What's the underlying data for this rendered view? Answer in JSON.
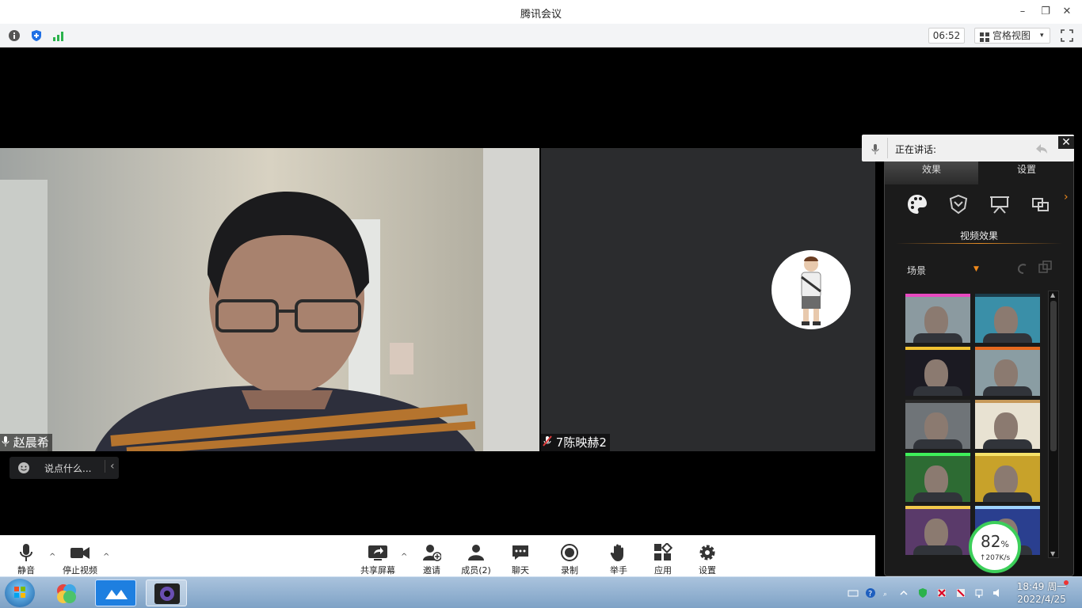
{
  "window": {
    "title": "腾讯会议",
    "minimize": "–",
    "restore": "❐",
    "close": "✕"
  },
  "toolbar": {
    "timer": "06:52",
    "view_mode": "宫格视图",
    "view_caret": "▾"
  },
  "participants": [
    {
      "name": "赵晨希",
      "muted": false
    },
    {
      "name": "7陈映赫2",
      "muted": true
    }
  ],
  "chat": {
    "placeholder": "说点什么...",
    "collapse": "‹"
  },
  "controls": {
    "mute": "静音",
    "stop_video": "停止视频",
    "share_screen": "共享屏幕",
    "invite": "邀请",
    "members": "成员(2)",
    "chat": "聊天",
    "record": "录制",
    "raise_hand": "举手",
    "apps": "应用",
    "settings": "设置",
    "caret": "^"
  },
  "effects_panel": {
    "speaking_label": "正在讲话:",
    "close": "✕",
    "tabs": [
      "效果",
      "设置"
    ],
    "section_title": "视频效果",
    "scene_label": "场景",
    "scene_caret": "▼",
    "more": "›",
    "thumbnails": [
      {
        "bg": "#8b9aa0",
        "accent": "#e84ac0"
      },
      {
        "bg": "#3a8fa8",
        "accent": "#1b3b4a"
      },
      {
        "bg": "#1b1a22",
        "accent": "#f1c232"
      },
      {
        "bg": "#8a9da3",
        "accent": "#e66a1f"
      },
      {
        "bg": "#6f7478",
        "accent": "#2a2a2a"
      },
      {
        "bg": "#e8e2d2",
        "accent": "#c79a5a"
      },
      {
        "bg": "#2d6b33",
        "accent": "#3ef05a"
      },
      {
        "bg": "#c8a22a",
        "accent": "#f6e26a"
      },
      {
        "bg": "#5a3a6a",
        "accent": "#f2c94c"
      },
      {
        "bg": "#2a3f8f",
        "accent": "#9fd4ff"
      }
    ]
  },
  "network": {
    "quality_value": "82",
    "quality_unit": "%",
    "speed": "↑207K/s",
    "ring_color": "#3ccf5a"
  },
  "taskbar": {
    "time": "18:49 周一",
    "date": "2022/4/25"
  }
}
